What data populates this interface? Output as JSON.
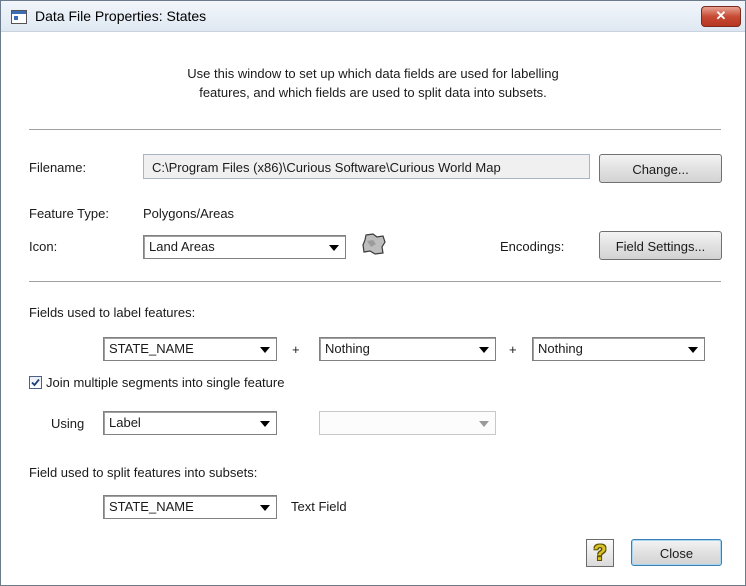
{
  "window": {
    "title": "Data File Properties: States",
    "close_glyph": "✕"
  },
  "description": {
    "line1": "Use this window to set up which data fields are used for labelling",
    "line2": "features, and which fields are used to split data into subsets."
  },
  "file": {
    "filename_label": "Filename:",
    "filename_value": "C:\\Program Files (x86)\\Curious Software\\Curious World Map",
    "change_button": "Change...",
    "feature_type_label": "Feature Type:",
    "feature_type_value": "Polygons/Areas",
    "icon_label": "Icon:",
    "icon_value": "Land Areas",
    "icon_preview": "map-region-icon",
    "encodings_label": "Encodings:",
    "field_settings_button": "Field Settings..."
  },
  "labels": {
    "section_label": "Fields used to label features:",
    "field1": "STATE_NAME",
    "field2": "Nothing",
    "field3": "Nothing",
    "plus": "+",
    "join_checkbox_label": "Join multiple segments into single feature",
    "join_checked": true,
    "using_label": "Using",
    "using_value": "Label",
    "using_secondary_value": ""
  },
  "subsets": {
    "section_label": "Field used to split features into subsets:",
    "field": "STATE_NAME",
    "field_type": "Text Field"
  },
  "footer": {
    "help_glyph": "?",
    "close_button": "Close"
  }
}
